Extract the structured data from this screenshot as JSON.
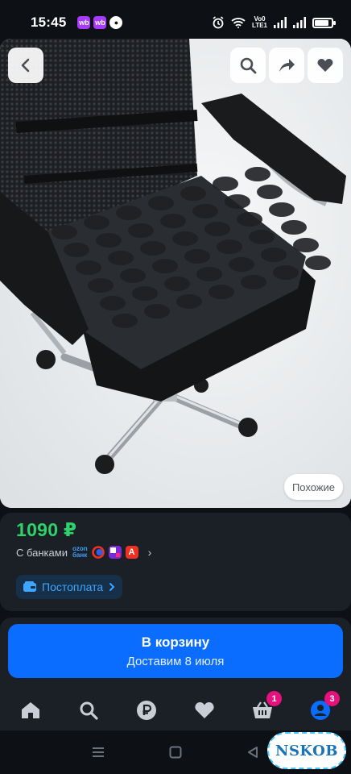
{
  "status_bar": {
    "time": "15:45",
    "notifications": [
      "wb",
      "wb",
      "ozon"
    ],
    "network_label": "Vo0\nLTE1",
    "battery_level": 0.75
  },
  "image_actions": {
    "back_icon": "chevron-left-icon",
    "search_icon": "search-icon",
    "share_icon": "share-arrow-icon",
    "favorite_icon": "heart-icon",
    "similar_label": "Похожие"
  },
  "product": {
    "price": "1090 ₽",
    "banks_label": "С банками",
    "ozon_bank_label": "ozon\nбанк",
    "postpay_label": "Постоплата"
  },
  "cart": {
    "button_title": "В корзину",
    "button_subtitle": "Доставим 8 июля"
  },
  "bottom_nav": {
    "items": [
      {
        "icon": "home-icon"
      },
      {
        "icon": "search-icon"
      },
      {
        "icon": "ruble-icon"
      },
      {
        "icon": "heart-icon"
      },
      {
        "icon": "cart-icon",
        "badge": "1"
      },
      {
        "icon": "profile-icon",
        "badge": "3"
      }
    ]
  },
  "watermark": "NSKOB",
  "colors": {
    "price_green": "#2fd16b",
    "accent_blue": "#0a6dff",
    "badge_pink": "#e6117c",
    "card_bg": "#1b1f26"
  }
}
